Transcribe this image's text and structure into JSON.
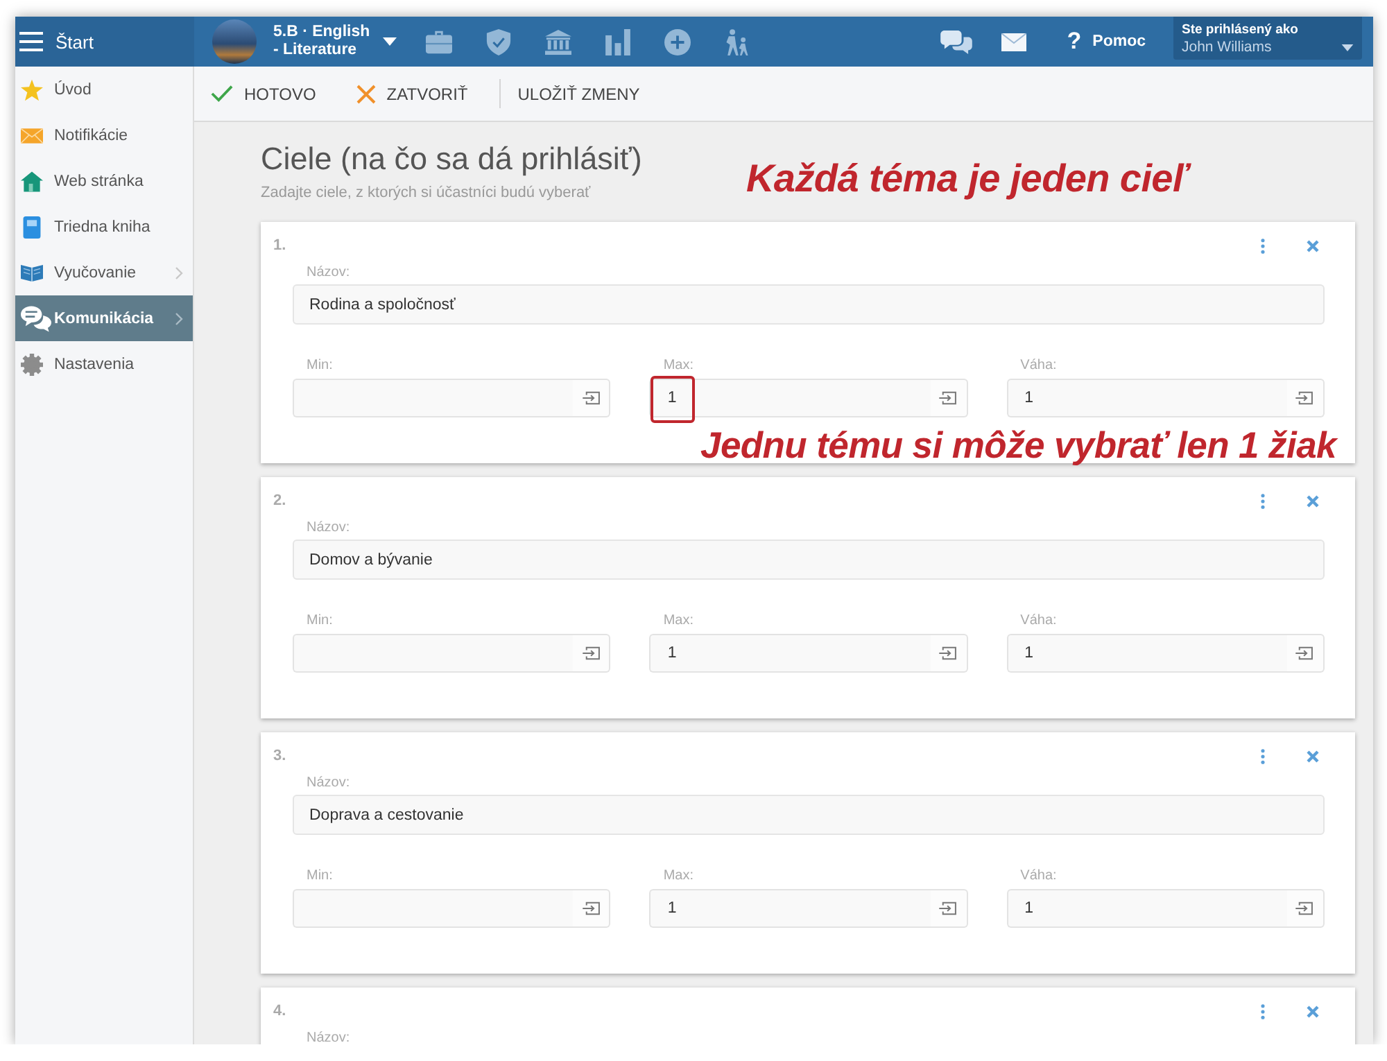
{
  "topbar": {
    "menu_label": "Štart",
    "class_label": "5.B · English - Literature",
    "help": {
      "icon": "?",
      "label": "Pomoc"
    },
    "user": {
      "caption": "Ste prihlásený ako",
      "name": "John Williams"
    }
  },
  "sidebar": {
    "items": [
      {
        "label": "Úvod",
        "selected": false,
        "has_submenu": false
      },
      {
        "label": "Notifikácie",
        "selected": false,
        "has_submenu": false
      },
      {
        "label": "Web stránka",
        "selected": false,
        "has_submenu": false
      },
      {
        "label": "Triedna kniha",
        "selected": false,
        "has_submenu": false
      },
      {
        "label": "Vyučovanie",
        "selected": false,
        "has_submenu": true
      },
      {
        "label": "Komunikácia",
        "selected": true,
        "has_submenu": true
      },
      {
        "label": "Nastavenia",
        "selected": false,
        "has_submenu": false
      }
    ]
  },
  "toolbar": {
    "buttons": [
      {
        "kind": "confirm",
        "label": "HOTOVO"
      },
      {
        "kind": "cancel",
        "label": "ZATVORIŤ"
      },
      {
        "kind": "save",
        "label": "ULOŽIŤ ZMENY"
      }
    ]
  },
  "page": {
    "title": "Ciele (na čo sa dá prihlásiť)",
    "subtitle": "Zadajte ciele, z ktorých si účastníci budú vyberať",
    "annotation": "Každá téma je jeden cieľ"
  },
  "goals": [
    {
      "number": "1.",
      "name_label": "Názov:",
      "name": "Rodina a spoločnosť",
      "fields": [
        {
          "label": "Min:",
          "highlighted": false
        },
        {
          "label": "Max:",
          "value": "1",
          "highlighted": true
        },
        {
          "label": "Váha:",
          "value": "1",
          "highlighted": false
        }
      ],
      "note": "Jednu tému si môže vybrať len 1 žiak"
    },
    {
      "number": "2.",
      "name_label": "Názov:",
      "name": "Domov a bývanie",
      "fields": [
        {
          "label": "Min:",
          "highlighted": false
        },
        {
          "label": "Max:",
          "value": "1",
          "highlighted": false
        },
        {
          "label": "Váha:",
          "value": "1",
          "highlighted": false
        }
      ]
    },
    {
      "number": "3.",
      "name_label": "Názov:",
      "name": "Doprava a cestovanie",
      "fields": [
        {
          "label": "Min:",
          "highlighted": false
        },
        {
          "label": "Max:",
          "value": "1",
          "highlighted": false
        },
        {
          "label": "Váha:",
          "value": "1",
          "highlighted": false
        }
      ]
    },
    {
      "number": "4.",
      "name_label": "Názov:"
    }
  ]
}
